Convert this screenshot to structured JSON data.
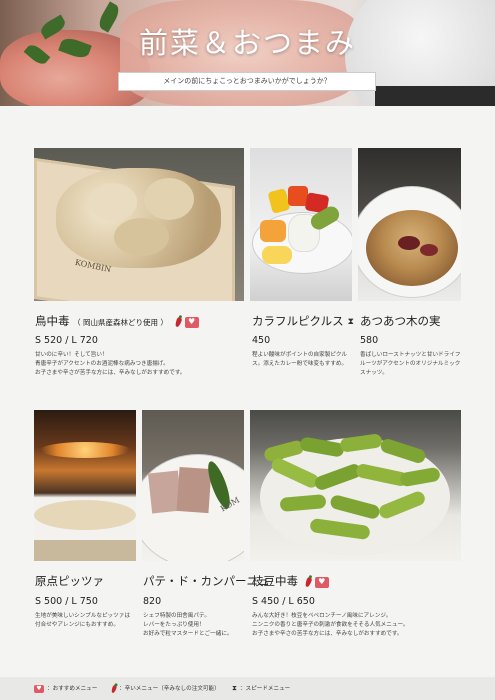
{
  "header": {
    "title": "前菜＆おつまみ",
    "subtitle": "メインの前にちょこっとおつまみいかがでしょうか？"
  },
  "items": [
    {
      "name": "鳥中毒",
      "name_sub": "（ 岡山県産森林どり使用 ）",
      "icons": [
        "chili-icon",
        "heart-icon"
      ],
      "price": "S 520 / L 720",
      "description_lines": [
        "甘いのに辛い！そして旨い！",
        "青唐辛子がアクセントのお酒泥棒な病みつき唐揚げ。",
        "お子さまや辛さが苦手な方には、辛みなしがおすすめです。"
      ]
    },
    {
      "name": "カラフルピクルス",
      "icons": [
        "hourglass-icon"
      ],
      "price": "450",
      "description_lines": [
        "程よい酸味がポイントの自家製ピクルス。添えたカレー粉で味変もすすめ。"
      ]
    },
    {
      "name": "あつあつ木の実",
      "icons": [],
      "price": "580",
      "description_lines": [
        "香ばしいローストナッツと甘いドライフルーツがアクセントのオリジナルミックスナッツ。"
      ]
    },
    {
      "name": "原点ピッツァ",
      "icons": [],
      "price": "S 500 / L 750",
      "description_lines": [
        "生地が美味しいシンプルなピッツァは",
        "付合せやアレンジにもおすすめ。"
      ]
    },
    {
      "name": "パテ・ド・カンパーニュ",
      "icons": [],
      "price": "820",
      "description_lines": [
        "シェフ特製の田舎風パテ。",
        "レバーをたっぷり使用！",
        "お好みで粒マスタードとご一緒に。"
      ]
    },
    {
      "name": "枝豆中毒",
      "icons": [
        "chili-icon",
        "heart-icon"
      ],
      "price": "S 450 / L 650",
      "description_lines": [
        "みんな大好き！枝豆をペペロンチーノ風味にアレンジ。",
        "ニンニクの香りと唐辛子の刺激が食欲をそそる人気メニュー。",
        "お子さまや辛さの苦手な方には、辛みなしがおすすめです。"
      ]
    }
  ],
  "legend": {
    "recommended": "：おすすめメニュー",
    "spicy": "：辛いメニュー（辛みなしの注文可能）",
    "speedy": "：スピードメニュー"
  },
  "colors": {
    "heart_badge": "#e05a65",
    "chili": "#c9262d",
    "footer_bg": "#e8e8e7",
    "page_bg": "#f4f4f3"
  }
}
